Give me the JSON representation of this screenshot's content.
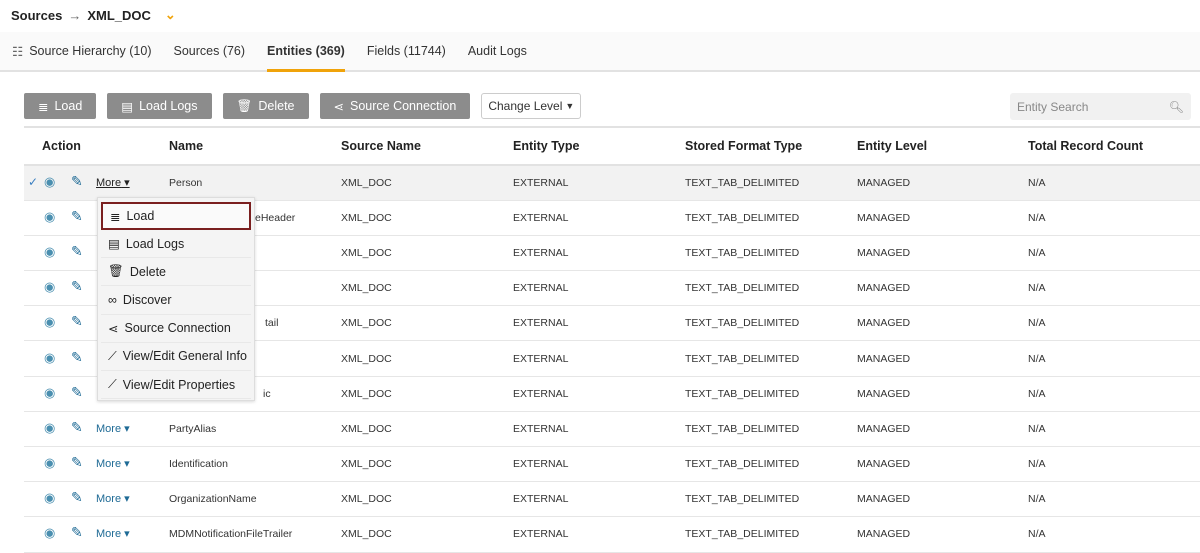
{
  "breadcrumb": {
    "root": "Sources",
    "current": "XML_DOC"
  },
  "tabs": [
    {
      "label": "Source Hierarchy (10)"
    },
    {
      "label": "Sources (76)"
    },
    {
      "label": "Entities (369)"
    },
    {
      "label": "Fields (11744)"
    },
    {
      "label": "Audit Logs"
    }
  ],
  "toolbar": {
    "load": "Load",
    "load_logs": "Load Logs",
    "delete": "Delete",
    "source_connection": "Source Connection",
    "change_level": "Change Level"
  },
  "search": {
    "placeholder": "Entity Search"
  },
  "table": {
    "headers": [
      "Action",
      "Name",
      "Source Name",
      "Entity Type",
      "Stored Format Type",
      "Entity Level",
      "Total Record Count"
    ],
    "more_label": "More",
    "rows": [
      {
        "name": "Person",
        "source": "XML_DOC",
        "type": "EXTERNAL",
        "format": "TEXT_TAB_DELIMITED",
        "level": "MANAGED",
        "count": "N/A"
      },
      {
        "name": "eHeader",
        "source": "XML_DOC",
        "type": "EXTERNAL",
        "format": "TEXT_TAB_DELIMITED",
        "level": "MANAGED",
        "count": "N/A"
      },
      {
        "name": "",
        "source": "XML_DOC",
        "type": "EXTERNAL",
        "format": "TEXT_TAB_DELIMITED",
        "level": "MANAGED",
        "count": "N/A"
      },
      {
        "name": "",
        "source": "XML_DOC",
        "type": "EXTERNAL",
        "format": "TEXT_TAB_DELIMITED",
        "level": "MANAGED",
        "count": "N/A"
      },
      {
        "name": "tail",
        "source": "XML_DOC",
        "type": "EXTERNAL",
        "format": "TEXT_TAB_DELIMITED",
        "level": "MANAGED",
        "count": "N/A"
      },
      {
        "name": "",
        "source": "XML_DOC",
        "type": "EXTERNAL",
        "format": "TEXT_TAB_DELIMITED",
        "level": "MANAGED",
        "count": "N/A"
      },
      {
        "name": "ic",
        "source": "XML_DOC",
        "type": "EXTERNAL",
        "format": "TEXT_TAB_DELIMITED",
        "level": "MANAGED",
        "count": "N/A"
      },
      {
        "name": "PartyAlias",
        "source": "XML_DOC",
        "type": "EXTERNAL",
        "format": "TEXT_TAB_DELIMITED",
        "level": "MANAGED",
        "count": "N/A"
      },
      {
        "name": "Identification",
        "source": "XML_DOC",
        "type": "EXTERNAL",
        "format": "TEXT_TAB_DELIMITED",
        "level": "MANAGED",
        "count": "N/A"
      },
      {
        "name": "OrganizationName",
        "source": "XML_DOC",
        "type": "EXTERNAL",
        "format": "TEXT_TAB_DELIMITED",
        "level": "MANAGED",
        "count": "N/A"
      },
      {
        "name": "MDMNotificationFileTrailer",
        "source": "XML_DOC",
        "type": "EXTERNAL",
        "format": "TEXT_TAB_DELIMITED",
        "level": "MANAGED",
        "count": "N/A"
      }
    ]
  },
  "menu": [
    {
      "label": "Load",
      "icon": "load-icon"
    },
    {
      "label": "Load Logs",
      "icon": "list-icon"
    },
    {
      "label": "Delete",
      "icon": "trash-icon"
    },
    {
      "label": "Discover",
      "icon": "binoculars-icon"
    },
    {
      "label": "Source Connection",
      "icon": "share-icon"
    },
    {
      "label": "View/Edit General Info",
      "icon": "pencil-icon"
    },
    {
      "label": "View/Edit Properties",
      "icon": "pencil-icon"
    }
  ]
}
